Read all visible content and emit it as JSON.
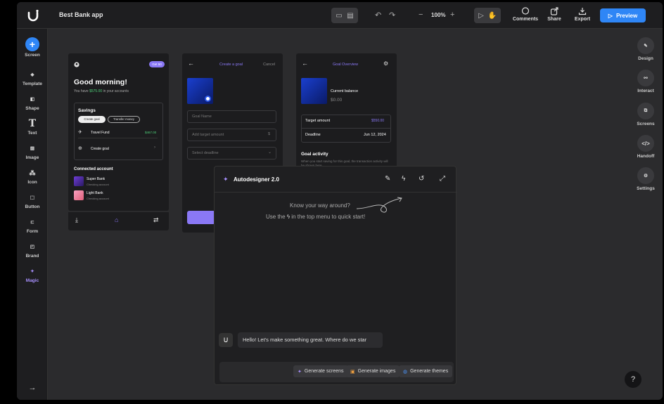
{
  "project_name": "Best Bank app",
  "toolbar": {
    "zoom": "100%",
    "comments": "Comments",
    "share": "Share",
    "export": "Export",
    "preview": "Preview"
  },
  "left_sidebar": [
    "Screen",
    "Template",
    "Shape",
    "Text",
    "Image",
    "Icon",
    "Button",
    "Form",
    "Brand",
    "Magic"
  ],
  "right_sidebar": [
    "Design",
    "Interact",
    "Screens",
    "Handoff",
    "Settings"
  ],
  "screen1": {
    "badge": "Get 50",
    "greeting": "Good morning!",
    "subtitle_pre": "You have ",
    "subtitle_amount": "$575.00",
    "subtitle_post": " in your accounts",
    "savings_title": "Savings",
    "btn_create_goal": "Create goal",
    "btn_transfer": "Transfer money",
    "fund_name": "Travel Fund",
    "fund_amount": "$467.00",
    "create_goal": "Create goal",
    "connected_title": "Connected account",
    "accounts": [
      {
        "name": "Super Bank",
        "type": "Checking account"
      },
      {
        "name": "Light Bank",
        "type": "Checking account"
      }
    ]
  },
  "screen2": {
    "title": "Create a goal",
    "cancel": "Cancel",
    "goal_name_placeholder": "Goal Name",
    "amount_placeholder": "Add target amount",
    "amount_suffix": "$",
    "deadline_placeholder": "Select deadline"
  },
  "screen3": {
    "title": "Goal Overview",
    "balance_label": "Current balance",
    "balance_value": "$0.00",
    "target_label": "Target amount",
    "target_value": "$550.00",
    "deadline_label": "Deadline",
    "deadline_value": "Jun 12, 2024",
    "activity_title": "Goal activity",
    "activity_text": "When you start saving for this goal, the transaction activity will be shown here"
  },
  "autodesigner": {
    "title": "Autodesigner 2.0",
    "hint_line1": "Know your way around?",
    "hint_line2_pre": "Use the",
    "hint_line2_post": "in the top menu to quick start!",
    "message": "Hello! Let's make something great. Where do we star",
    "chips": [
      "Generate screens",
      "Generate images",
      "Generate themes"
    ]
  },
  "help": "?",
  "colors": {
    "accent": "#2f86f6",
    "purple": "#8a78f5",
    "green": "#4fd27a"
  }
}
